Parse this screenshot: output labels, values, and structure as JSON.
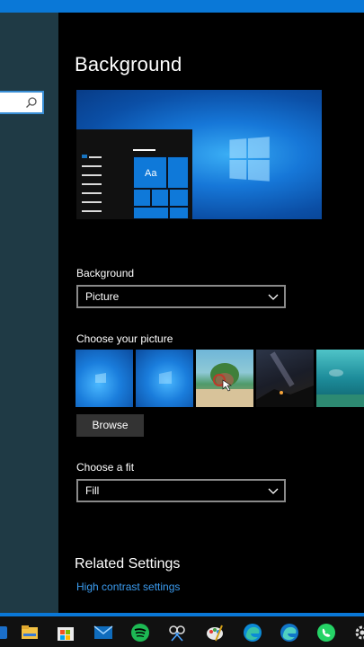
{
  "title": "Background",
  "preview": {
    "tile_label": "Aa"
  },
  "background_section": {
    "label": "Background",
    "selected": "Picture"
  },
  "picture_section": {
    "label": "Choose your picture",
    "thumbnails": [
      "windows-blue-1",
      "windows-blue-2",
      "lake-rock-island",
      "night-sky",
      "underwater-turquoise"
    ]
  },
  "browse_label": "Browse",
  "fit_section": {
    "label": "Choose a fit",
    "selected": "Fill"
  },
  "related": {
    "title": "Related Settings",
    "link": "High contrast settings"
  },
  "taskbar": {
    "icons": [
      "partial-app-icon",
      "file-explorer-icon",
      "store-icon",
      "mail-icon",
      "spotify-icon",
      "snipping-tool-icon",
      "paint-icon",
      "edge-icon",
      "edge-beta-icon",
      "whatsapp-icon",
      "settings-icon"
    ]
  },
  "colors": {
    "accent": "#0a78d7",
    "link": "#3b9cf0",
    "sidebar": "#1f3a45"
  }
}
